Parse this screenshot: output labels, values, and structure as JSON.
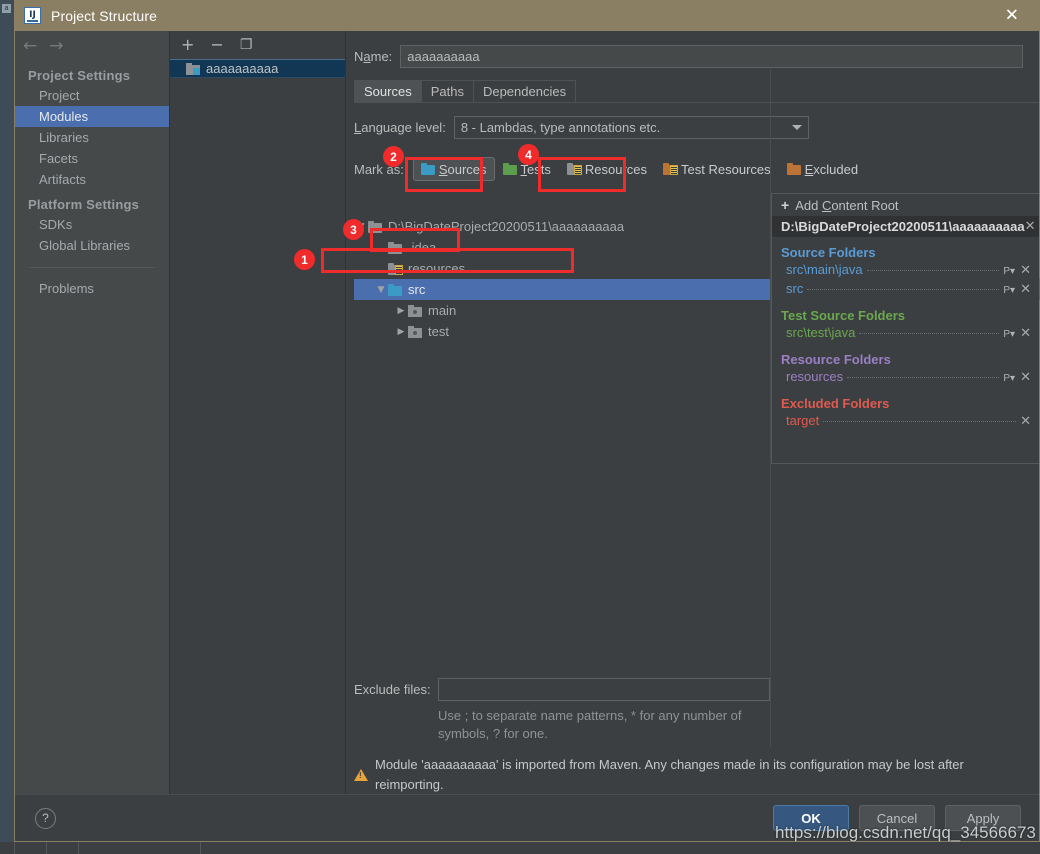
{
  "window": {
    "title": "Project Structure",
    "app_icon": "intellij-idea-icon",
    "close_label": "✕"
  },
  "nav": {
    "back_icon": "←",
    "forward_icon": "→",
    "groups": [
      {
        "label": "Project Settings",
        "items": [
          {
            "label": "Project",
            "selected": false
          },
          {
            "label": "Modules",
            "selected": true
          },
          {
            "label": "Libraries",
            "selected": false
          },
          {
            "label": "Facets",
            "selected": false
          },
          {
            "label": "Artifacts",
            "selected": false
          }
        ]
      },
      {
        "label": "Platform Settings",
        "items": [
          {
            "label": "SDKs",
            "selected": false
          },
          {
            "label": "Global Libraries",
            "selected": false
          }
        ]
      }
    ],
    "problems_label": "Problems"
  },
  "modules_panel": {
    "toolbar": {
      "add_label": "+",
      "remove_label": "−",
      "copy_label": "❐"
    },
    "items": [
      {
        "label": "aaaaaaaaaa",
        "icon": "module-folder-icon",
        "selected": true
      }
    ]
  },
  "main": {
    "name_label": "Name:",
    "name_label_pre": "N",
    "name_label_u": "a",
    "name_label_post": "me:",
    "name_value": "aaaaaaaaaa",
    "tabs": [
      {
        "label": "Sources",
        "active": true
      },
      {
        "label": "Paths",
        "active": false
      },
      {
        "label": "Dependencies",
        "active": false
      }
    ],
    "language_level": {
      "label_pre": "",
      "label_u": "L",
      "label_post": "anguage level:",
      "label": "Language level:",
      "value": "8 - Lambdas, type annotations etc."
    },
    "mark_as": {
      "label": "Mark as:",
      "buttons": [
        {
          "label": "Sources",
          "u": "S",
          "rest": "ources",
          "icon": "sources-folder-icon",
          "pressed": true
        },
        {
          "label": "Tests",
          "u": "T",
          "rest": "ests",
          "icon": "tests-folder-icon",
          "pressed": false
        },
        {
          "label": "Resources",
          "u": "",
          "rest": "Resources",
          "icon": "resources-folder-icon",
          "pressed": false
        },
        {
          "label": "Test Resources",
          "u": "",
          "rest": "Test Resources",
          "icon": "test-resources-folder-icon",
          "pressed": false
        },
        {
          "label": "Excluded",
          "u": "E",
          "rest": "xcluded",
          "icon": "excluded-folder-icon",
          "pressed": false
        }
      ]
    },
    "tree": [
      {
        "label": "D:\\BigDateProject20200511\\aaaaaaaaaa",
        "depth": 0,
        "twisty": "▼",
        "icon": "gray-folder-icon",
        "selected": false
      },
      {
        "label": ".idea",
        "depth": 1,
        "twisty": "",
        "icon": "gray-folder-icon",
        "selected": false
      },
      {
        "label": "resources",
        "depth": 1,
        "twisty": "",
        "icon": "resources-folder-icon",
        "selected": false
      },
      {
        "label": "src",
        "depth": 1,
        "twisty": "▼",
        "icon": "sources-folder-icon",
        "selected": true
      },
      {
        "label": "main",
        "depth": 2,
        "twisty": "▶",
        "icon": "content-folder-icon",
        "selected": false
      },
      {
        "label": "test",
        "depth": 2,
        "twisty": "▶",
        "icon": "content-folder-icon",
        "selected": false
      }
    ],
    "exclude": {
      "label": "Exclude files:",
      "value": "",
      "hint": "Use ; to separate name patterns, * for any number of symbols, ? for one."
    },
    "warning": "Module 'aaaaaaaaaa' is imported from Maven. Any changes made in its configuration may be lost after reimporting."
  },
  "content_root_panel": {
    "add_content_root": {
      "plus": "+",
      "label": "Add Content Root",
      "u": "C",
      "pre": "Add ",
      "post": "ontent Root"
    },
    "root_path": "D:\\BigDateProject20200511\\aaaaaaaaaa",
    "root_close": "✕",
    "groups": [
      {
        "title": "Source Folders",
        "color": "#5a9bd5",
        "entries": [
          {
            "name": "src\\main\\java",
            "has_props": true,
            "has_close": true
          },
          {
            "name": "src",
            "has_props": true,
            "has_close": true
          }
        ]
      },
      {
        "title": "Test Source Folders",
        "color": "#6aa84f",
        "entries": [
          {
            "name": "src\\test\\java",
            "has_props": true,
            "has_close": true
          }
        ]
      },
      {
        "title": "Resource Folders",
        "color": "#9b7fc4",
        "entries": [
          {
            "name": "resources",
            "has_props": true,
            "has_close": true
          }
        ]
      },
      {
        "title": "Excluded Folders",
        "color": "#e05a50",
        "entries": [
          {
            "name": "target",
            "has_props": false,
            "has_close": true
          }
        ]
      }
    ],
    "props_glyph": "P▾",
    "close_glyph": "✕"
  },
  "footer": {
    "help_label": "?",
    "buttons": [
      {
        "label": "OK",
        "style": "default"
      },
      {
        "label": "Cancel",
        "style": "normal"
      },
      {
        "label": "Apply",
        "style": "normal"
      }
    ]
  },
  "annotations": {
    "numbers": [
      "1",
      "2",
      "3",
      "4"
    ],
    "color": "#f02b2b"
  },
  "watermark": "https://blog.csdn.net/qq_34566673"
}
